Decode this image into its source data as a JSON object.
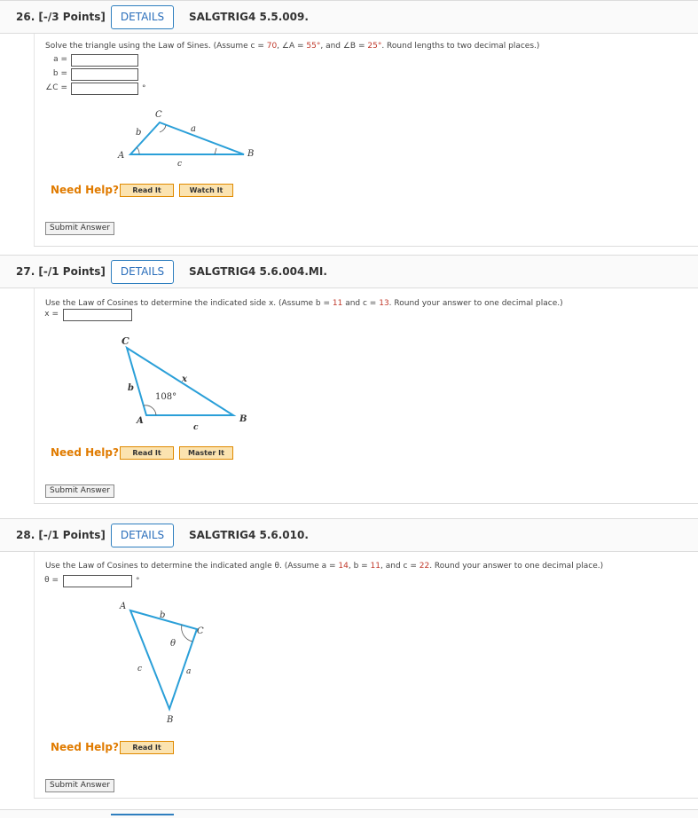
{
  "q26": {
    "number": "26. [-/3 Points]",
    "details": "DETAILS",
    "code": "SALGTRIG4 5.5.009.",
    "prompt_a": "Solve the triangle using the Law of Sines. (Assume c = ",
    "c_val": "70",
    "prompt_b": ", ∠A = ",
    "A_val": "55°",
    "prompt_c": ", and ∠B = ",
    "B_val": "25°",
    "prompt_d": ". Round lengths to two decimal places.)",
    "labels": [
      "a =",
      "b =",
      "∠C ="
    ],
    "degree": "°",
    "fig": {
      "C": "C",
      "a": "a",
      "b": "b",
      "A": "A",
      "B": "B",
      "c": "c"
    },
    "need_help": "Need Help?",
    "read_it": "Read It",
    "watch_it": "Watch It",
    "submit": "Submit Answer"
  },
  "q27": {
    "number": "27. [-/1 Points]",
    "details": "DETAILS",
    "code": "SALGTRIG4 5.6.004.MI.",
    "prompt_a": "Use the Law of Cosines to determine the indicated side x. (Assume b = ",
    "b_val": "11",
    "prompt_b": " and c = ",
    "c_val": "13",
    "prompt_c": ". Round your answer to one decimal place.)",
    "label": "x =",
    "fig": {
      "C": "C",
      "x": "x",
      "b": "b",
      "angle": "108°",
      "A": "A",
      "c": "c",
      "B": "B"
    },
    "need_help": "Need Help?",
    "read_it": "Read It",
    "master_it": "Master It",
    "submit": "Submit Answer"
  },
  "q28": {
    "number": "28. [-/1 Points]",
    "details": "DETAILS",
    "code": "SALGTRIG4 5.6.010.",
    "prompt_a": "Use the Law of Cosines to determine the indicated angle θ. (Assume a = ",
    "a_val": "14",
    "prompt_b": ", b = ",
    "b_val": "11",
    "prompt_c": ", and c = ",
    "c_val": "22",
    "prompt_d": ". Round your answer to one decimal place.)",
    "label": "θ =",
    "degree": "°",
    "fig": {
      "A": "A",
      "b": "b",
      "C": "C",
      "theta": "θ",
      "c": "c",
      "a": "a",
      "B": "B"
    },
    "need_help": "Need Help?",
    "read_it": "Read It",
    "submit": "Submit Answer"
  },
  "colors": {
    "accent": "#2f7fbf",
    "help": "#e07b00",
    "highlight": "#c0392b",
    "triangle": "#2a9fd8"
  }
}
